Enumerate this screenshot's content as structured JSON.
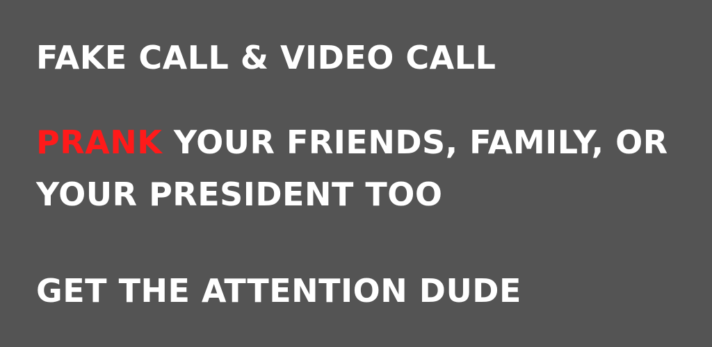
{
  "colors": {
    "background": "#545454",
    "text": "#ffffff",
    "accent": "#ff1a1a"
  },
  "banner": {
    "headline": "FAKE CALL & VIDEO CALL",
    "prank_word": "PRANK",
    "prank_rest": " YOUR FRIENDS, FAMILY, OR",
    "prank_line2": "YOUR PRESIDENT TOO",
    "tagline": "GET THE ATTENTION DUDE"
  }
}
